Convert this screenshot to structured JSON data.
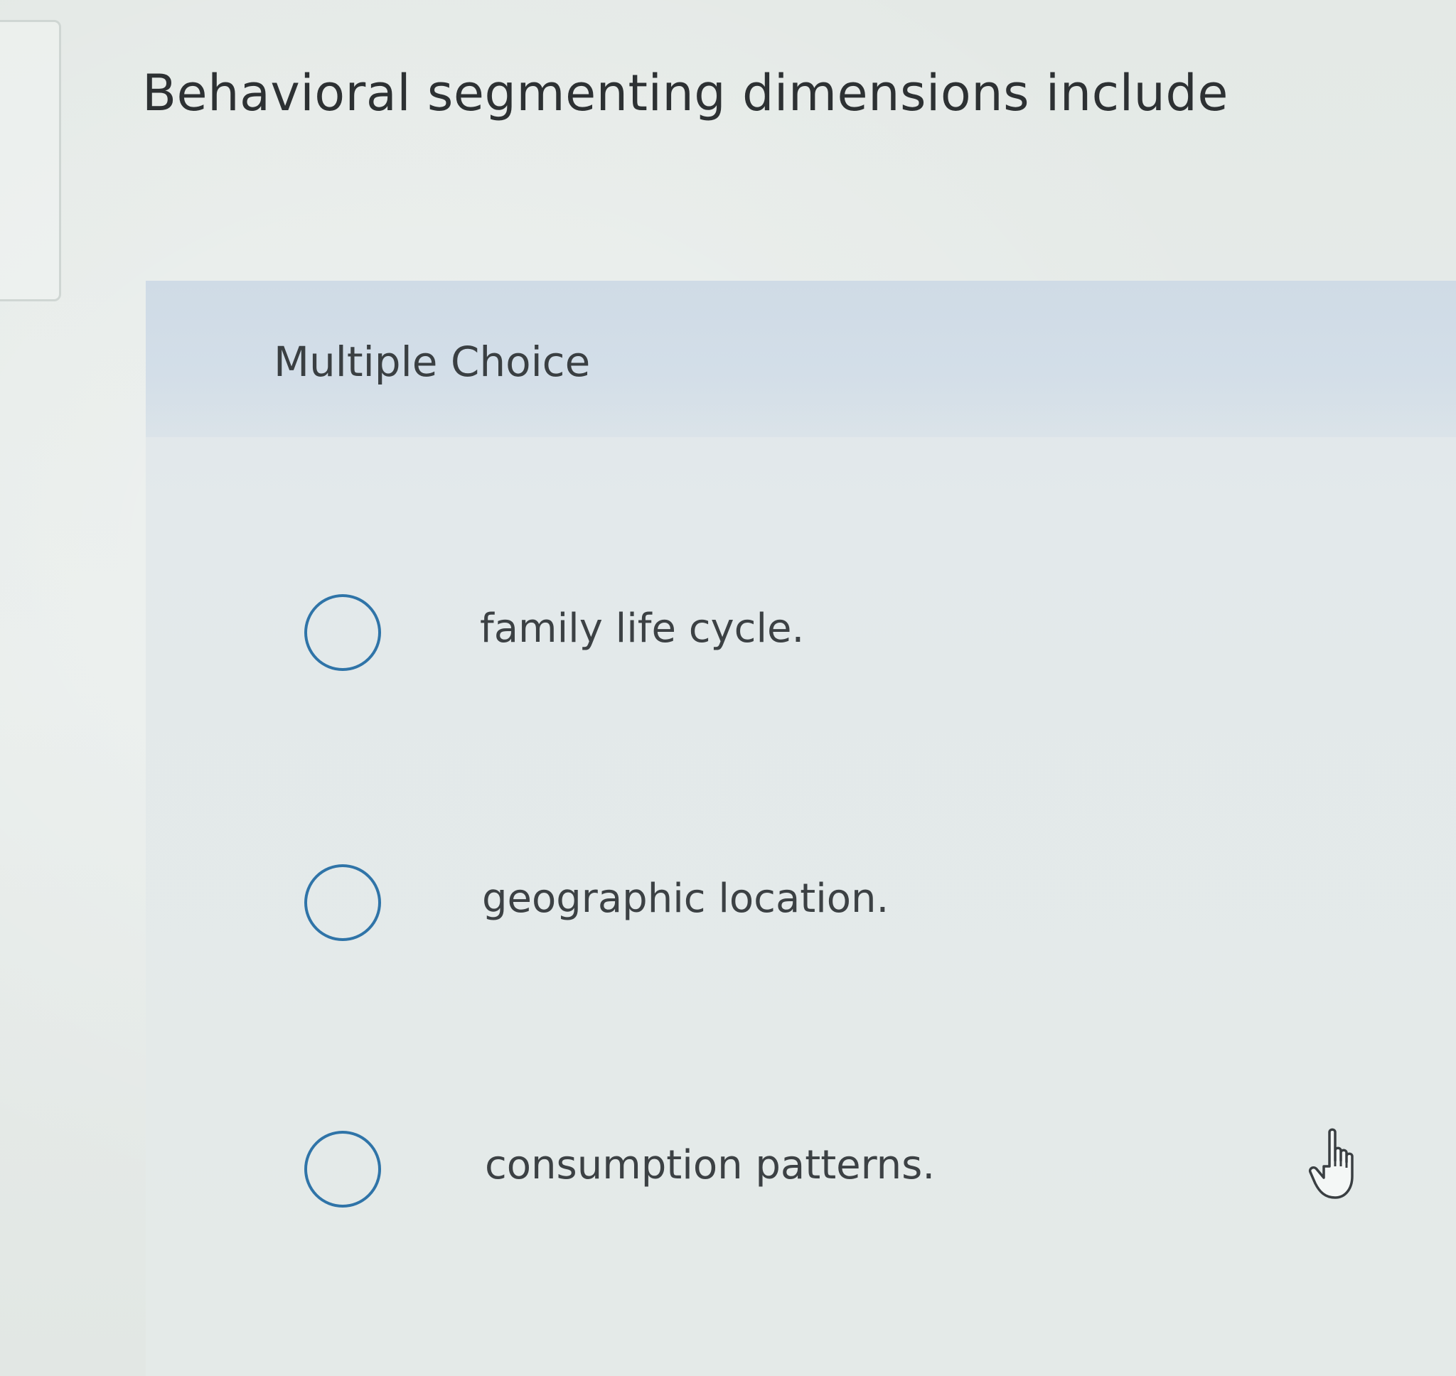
{
  "question": {
    "text": "Behavioral segmenting dimensions include"
  },
  "choice_panel": {
    "type_label": "Multiple Choice",
    "options": [
      {
        "label": "family life cycle.",
        "selected": false
      },
      {
        "label": "geographic location.",
        "selected": false
      },
      {
        "label": "consumption patterns.",
        "selected": false
      }
    ]
  },
  "colors": {
    "radio_border": "#2f74a8",
    "header_band": "#d3dee8",
    "text": "#2d3133"
  },
  "icons": {
    "cursor": "hand-pointer-icon"
  }
}
